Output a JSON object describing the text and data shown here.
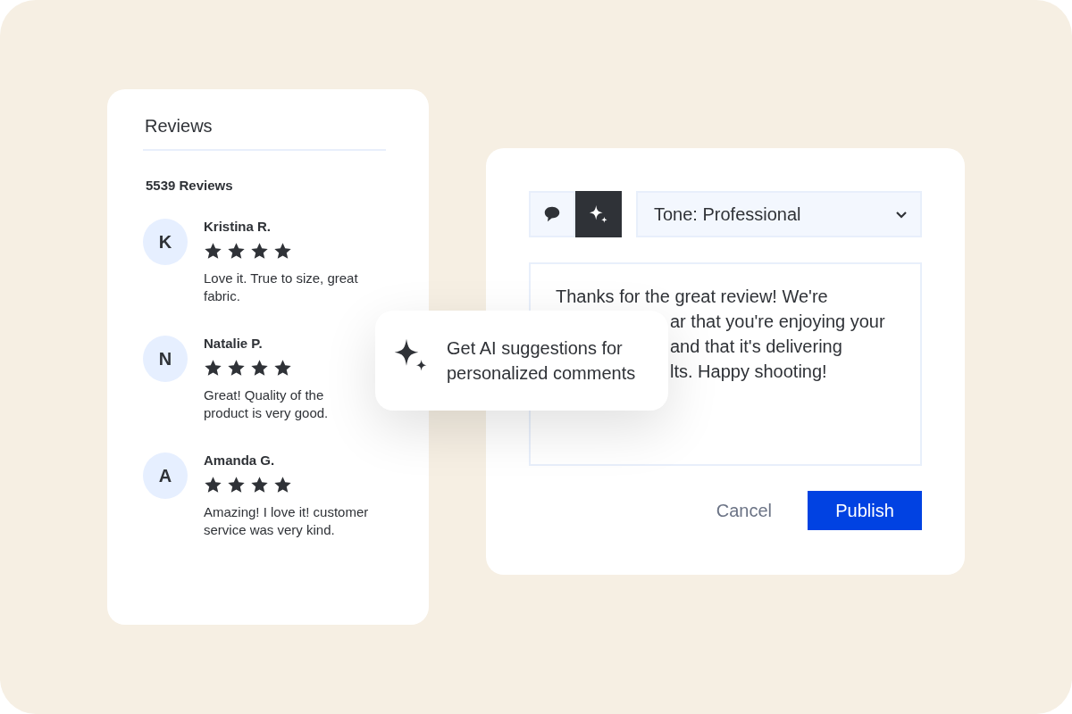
{
  "reviews_panel": {
    "title": "Reviews",
    "count": "5539 Reviews",
    "reviews": [
      {
        "initial": "K",
        "name": "Kristina R.",
        "stars": 4,
        "text": "Love it. True to size, great fabric."
      },
      {
        "initial": "N",
        "name": "Natalie P.",
        "stars": 4,
        "text": "Great! Quality of the product is very good."
      },
      {
        "initial": "A",
        "name": "Amanda G.",
        "stars": 4,
        "text": "Amazing! I love it! customer service was very kind."
      }
    ]
  },
  "reply_panel": {
    "modes": [
      {
        "kind": "comment",
        "selected": false
      },
      {
        "kind": "ai",
        "selected": true
      }
    ],
    "tone": "Tone: Professional",
    "comment": {
      "first_line": "Thanks for the great review! We're",
      "partially_hidden_lines": [
        "ar that you're enjoying your",
        "and that it's delivering",
        "lts. Happy shooting!"
      ]
    },
    "buttons": [
      {
        "kind": "secondary",
        "label": "Cancel"
      },
      {
        "kind": "primary",
        "label": "Publish"
      }
    ]
  },
  "tooltip": {
    "text": "Get AI suggestions for personalized comments"
  }
}
